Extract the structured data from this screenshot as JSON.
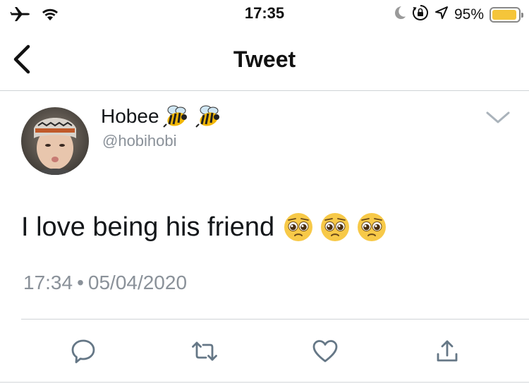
{
  "status_bar": {
    "time": "17:35",
    "battery_percent_text": "95%",
    "battery_level": 0.95,
    "battery_color": "#f5c53a",
    "left_icons": [
      "airplane-mode-icon",
      "wifi-icon"
    ],
    "right_icons": [
      "do-not-disturb-moon-icon",
      "orientation-lock-icon",
      "location-arrow-icon"
    ]
  },
  "nav": {
    "title": "Tweet",
    "back_icon": "chevron-left-icon"
  },
  "tweet": {
    "author": {
      "display_name": "Hobee",
      "name_emojis": [
        "🐝",
        "🐝"
      ],
      "handle": "@hobihobi"
    },
    "text": "I love being his friend",
    "text_emojis": [
      "🥺",
      "🥺",
      "🥺"
    ],
    "time": "17:34",
    "separator": "•",
    "date": "05/04/2020",
    "menu_icon": "chevron-down-icon"
  },
  "actions": [
    {
      "name": "reply",
      "icon": "reply-bubble-icon"
    },
    {
      "name": "retweet",
      "icon": "retweet-icon"
    },
    {
      "name": "like",
      "icon": "heart-icon"
    },
    {
      "name": "share",
      "icon": "share-icon"
    }
  ],
  "colors": {
    "action_icon": "#657786",
    "secondary_text": "#8a9199",
    "primary_text": "#14171a",
    "divider": "#cfd3d6"
  }
}
